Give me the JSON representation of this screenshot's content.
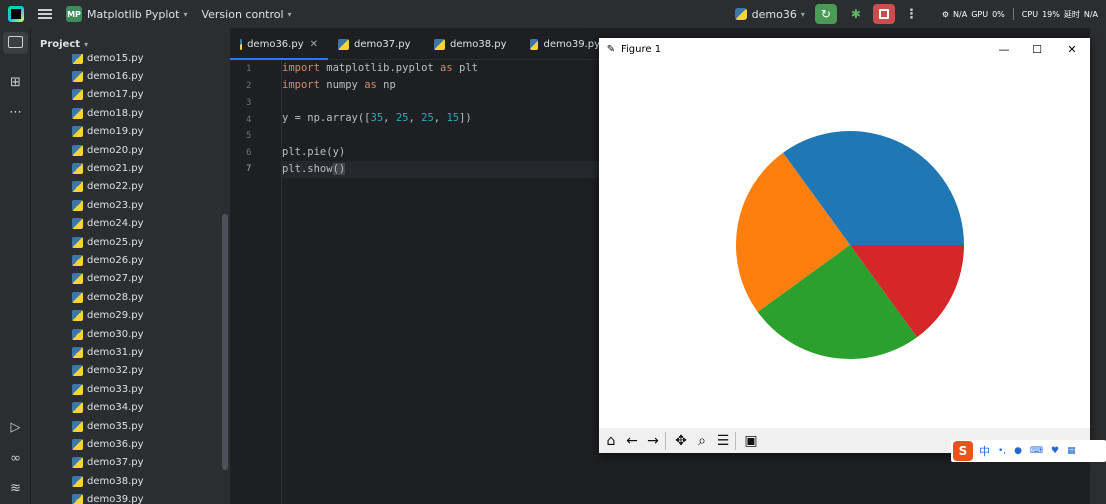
{
  "topbar": {
    "project_badge": "MP",
    "project_name": "Matplotlib Pyplot",
    "version_control": "Version control",
    "run_config": "demo36",
    "npu": "N/A",
    "gpu_label": "GPU",
    "gpu_value": "0%",
    "cpu_label": "CPU",
    "cpu_value": "19%",
    "extra_label": "延时",
    "extra_value": "N/A"
  },
  "project_panel": {
    "title": "Project",
    "files": [
      "demo15.py",
      "demo16.py",
      "demo17.py",
      "demo18.py",
      "demo19.py",
      "demo20.py",
      "demo21.py",
      "demo22.py",
      "demo23.py",
      "demo24.py",
      "demo25.py",
      "demo26.py",
      "demo27.py",
      "demo28.py",
      "demo29.py",
      "demo30.py",
      "demo31.py",
      "demo32.py",
      "demo33.py",
      "demo34.py",
      "demo35.py",
      "demo36.py",
      "demo37.py",
      "demo38.py",
      "demo39.py"
    ]
  },
  "tabs": [
    {
      "label": "demo36.py",
      "active": true
    },
    {
      "label": "demo37.py",
      "active": false
    },
    {
      "label": "demo38.py",
      "active": false
    },
    {
      "label": "demo39.py",
      "active": false
    }
  ],
  "code": {
    "line_numbers": [
      "1",
      "2",
      "3",
      "4",
      "5",
      "6",
      "7"
    ],
    "line1_kw1": "import",
    "line1_mod": " matplotlib.pyplot ",
    "line1_kw2": "as",
    "line1_alias": " plt",
    "line2_kw1": "import",
    "line2_mod": " numpy ",
    "line2_kw2": "as",
    "line2_alias": " np",
    "line4_pre": "y = np.array([",
    "line4_n1": "35",
    "line4_c1": ", ",
    "line4_n2": "25",
    "line4_c2": ", ",
    "line4_n3": "25",
    "line4_c3": ", ",
    "line4_n4": "15",
    "line4_post": "])",
    "line6": "plt.pie(y)",
    "line7_pre": "plt.show",
    "line7_paren": "()"
  },
  "figure": {
    "title": "Figure 1",
    "min": "—",
    "max": "☐",
    "close": "✕"
  },
  "tray": {
    "ime": "S",
    "zh": "中"
  },
  "chart_data": {
    "type": "pie",
    "values": [
      35,
      25,
      25,
      15
    ],
    "colors": [
      "#1f77b4",
      "#ff7f0e",
      "#2ca02c",
      "#d62728"
    ],
    "start_angle": 0,
    "direction": "counterclockwise"
  }
}
